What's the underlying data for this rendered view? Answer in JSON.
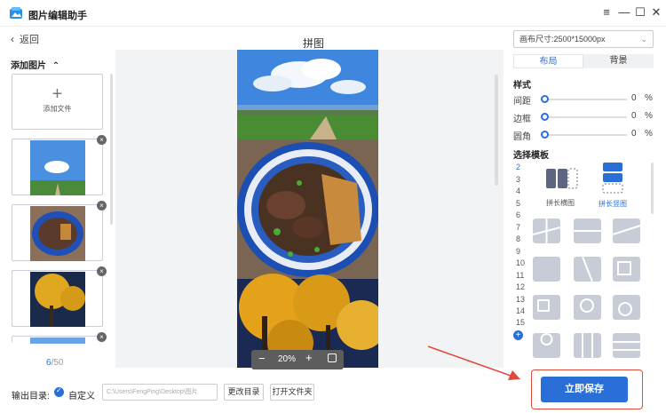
{
  "window": {
    "title": "图片编辑助手",
    "min_icon": "minimize-icon",
    "max_icon": "maximize-icon",
    "close_icon": "close-icon",
    "menu_icon": "menu-icon"
  },
  "left": {
    "back_label": "返回",
    "add_title": "添加图片",
    "add_file_label": "添加文件",
    "page_current": "6",
    "page_total": "/50"
  },
  "center": {
    "title": "拼图",
    "zoom_value": "20%"
  },
  "right": {
    "canvas_size": "画布尺寸:2500*15000px",
    "tabs": [
      {
        "label": "布局"
      },
      {
        "label": "背景"
      }
    ],
    "style_title": "样式",
    "sliders": [
      {
        "label": "间距",
        "value": "0",
        "unit": "%"
      },
      {
        "label": "边框",
        "value": "0",
        "unit": "%"
      },
      {
        "label": "圆角",
        "value": "0",
        "unit": "%"
      }
    ],
    "template_title": "选择模板",
    "numbers": [
      "2",
      "3",
      "4",
      "5",
      "6",
      "7",
      "8",
      "9",
      "10",
      "11",
      "12",
      "13",
      "14",
      "15"
    ],
    "tpl_horizontal": "拼长横图",
    "tpl_vertical": "拼长竖图"
  },
  "bottom": {
    "output_label": "输出目录:",
    "custom_label": "自定义",
    "path": "C:\\Users\\FengPing\\Desktop\\图片",
    "change_dir": "更改目录",
    "open_folder": "打开文件夹",
    "save_now": "立即保存"
  },
  "colors": {
    "accent": "#2a6fd8",
    "highlight": "#e04a3a"
  }
}
